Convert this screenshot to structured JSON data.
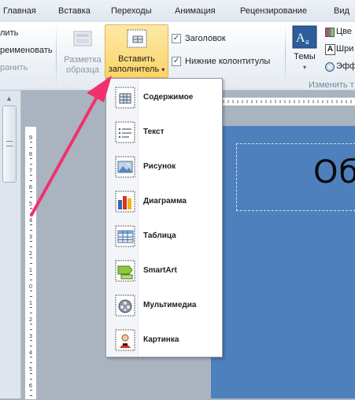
{
  "tabs": [
    "Главная",
    "Вставка",
    "Переходы",
    "Анимация",
    "Рецензирование",
    "Вид"
  ],
  "ribbon": {
    "left_items": [
      "лить",
      "реименовать",
      "ранить"
    ],
    "layout_button": "Разметка образца",
    "insert_placeholder": {
      "line1": "Вставить",
      "line2": "заполнитель"
    },
    "checkboxes": [
      {
        "label": "Заголовок",
        "checked": true
      },
      {
        "label": "Нижние колонтитулы",
        "checked": true
      }
    ],
    "themes_label": "Темы",
    "theme_items": [
      "Цве",
      "Шри",
      "Эфф"
    ],
    "group_label": "Изменить т"
  },
  "menu": {
    "items": [
      {
        "label": "Содержимое",
        "icon": "content-icon"
      },
      {
        "label": "Текст",
        "icon": "text-icon"
      },
      {
        "label": "Рисунок",
        "icon": "picture-icon"
      },
      {
        "label": "Диаграмма",
        "icon": "chart-icon"
      },
      {
        "label": "Таблица",
        "icon": "table-icon"
      },
      {
        "label": "SmartArt",
        "icon": "smartart-icon"
      },
      {
        "label": "Мультимедиа",
        "icon": "media-icon"
      },
      {
        "label": "Картинка",
        "icon": "clipart-icon"
      }
    ]
  },
  "slide": {
    "title_fragment": "Об"
  },
  "colors": {
    "accent_arrow": "#f0316e",
    "slide_bg": "#4e80bd",
    "active_button": "#fbd468"
  }
}
